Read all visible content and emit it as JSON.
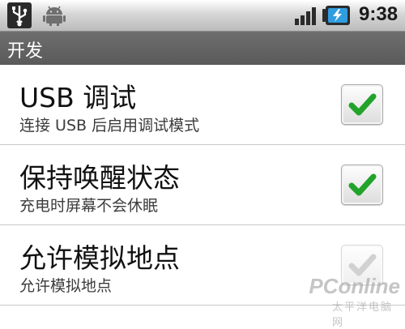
{
  "status_bar": {
    "time": "9:38",
    "icons": [
      "usb-icon",
      "android-debug-icon",
      "signal-strength-icon",
      "battery-charging-icon"
    ]
  },
  "title_bar": {
    "title": "开发"
  },
  "settings": [
    {
      "title": "USB 调试",
      "subtitle": "连接 USB 后启用调试模式",
      "checked": true,
      "enabled": true
    },
    {
      "title": "保持唤醒状态",
      "subtitle": "充电时屏幕不会休眠",
      "checked": true,
      "enabled": true
    },
    {
      "title": "允许模拟地点",
      "subtitle": "允许模拟地点",
      "checked": true,
      "enabled": false
    }
  ],
  "watermark": {
    "brand": "PConline",
    "tagline": "太平洋电脑网"
  },
  "colors": {
    "check_green": "#22a32a",
    "title_bar_bg": "#626262",
    "status_bar_bg": "#d6d6d6"
  }
}
